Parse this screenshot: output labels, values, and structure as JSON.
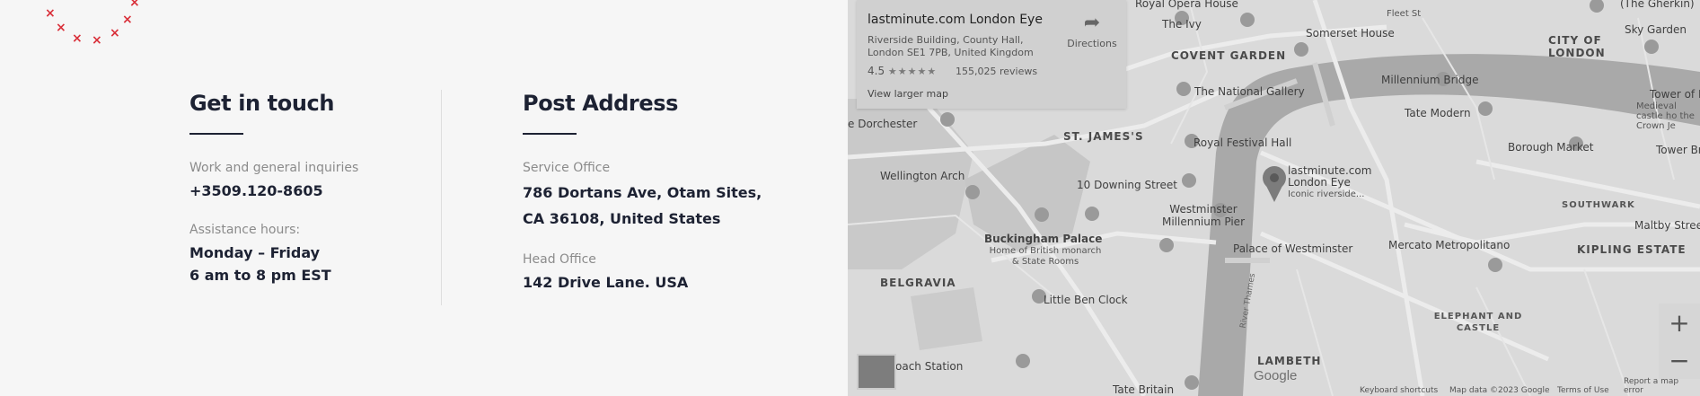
{
  "contact": {
    "heading": "Get in touch",
    "inquiries_label": "Work and general inquiries",
    "phone": "+3509.120-8605",
    "hours_label": "Assistance hours:",
    "hours_days": "Monday – Friday",
    "hours_time": "6 am to 8 pm EST"
  },
  "address": {
    "heading": "Post Address",
    "service_label": "Service Office",
    "service_line1": "786 Dortans Ave, Otam Sites,",
    "service_line2": "CA 36108, United States",
    "head_label": "Head Office",
    "head_value": "142 Drive Lane. USA"
  },
  "map": {
    "place_title": "lastminute.com London Eye",
    "place_address": "Riverside Building, County Hall, London SE1 7PB, United Kingdom",
    "rating": "4.5",
    "stars": "★★★★★",
    "reviews": "155,025 reviews",
    "larger_map": "View larger map",
    "directions": "Directions",
    "labels": {
      "royal_opera": "Royal Opera House",
      "the_ivy": "The Ivy",
      "fleet_st": "Fleet St",
      "gherkin": "(The Gherkin)",
      "covent_garden": "COVENT GARDEN",
      "somerset": "Somerset House",
      "city_of_london": "CITY OF LONDON",
      "sky_garden": "Sky Garden",
      "national_gallery": "The National Gallery",
      "millennium_bridge": "Millennium Bridge",
      "tower_of_london": "Tower of Lon",
      "tower_sub": "Medieval castle ho the Crown Je",
      "dorchester": "e Dorchester",
      "st_james": "ST. JAMES'S",
      "royal_festival": "Royal Festival Hall",
      "tate_modern": "Tate Modern",
      "borough_market": "Borough Market",
      "tower_br": "Tower Br",
      "wellington": "Wellington Arch",
      "downing": "10 Downing Street",
      "london_eye_pin": "lastminute.com London Eye",
      "london_eye_sub": "Iconic riverside...",
      "southwark": "SOUTHWARK",
      "maltby": "Maltby Stree",
      "westminster_pier": "Westminster Millennium Pier",
      "buckingham": "Buckingham Palace",
      "buckingham_sub": "Home of British monarch & State Rooms",
      "palace_westminster": "Palace of Westminster",
      "mercato": "Mercato Metropolitano",
      "kipling": "KIPLING ESTATE",
      "belgravia": "BELGRAVIA",
      "big_ben": "Little Ben Clock",
      "elephant": "ELEPHANT AND CASTLE",
      "lambeth": "LAMBETH",
      "coach_station": "oach Station",
      "tate_britain": "Tate Britain",
      "river_thames": "River Thames"
    },
    "footer": {
      "shortcuts": "Keyboard shortcuts",
      "mapdata": "Map data ©2023 Google",
      "terms": "Terms of Use",
      "report": "Report a map error"
    },
    "google": "Google",
    "zoom_in": "+",
    "zoom_out": "−"
  }
}
